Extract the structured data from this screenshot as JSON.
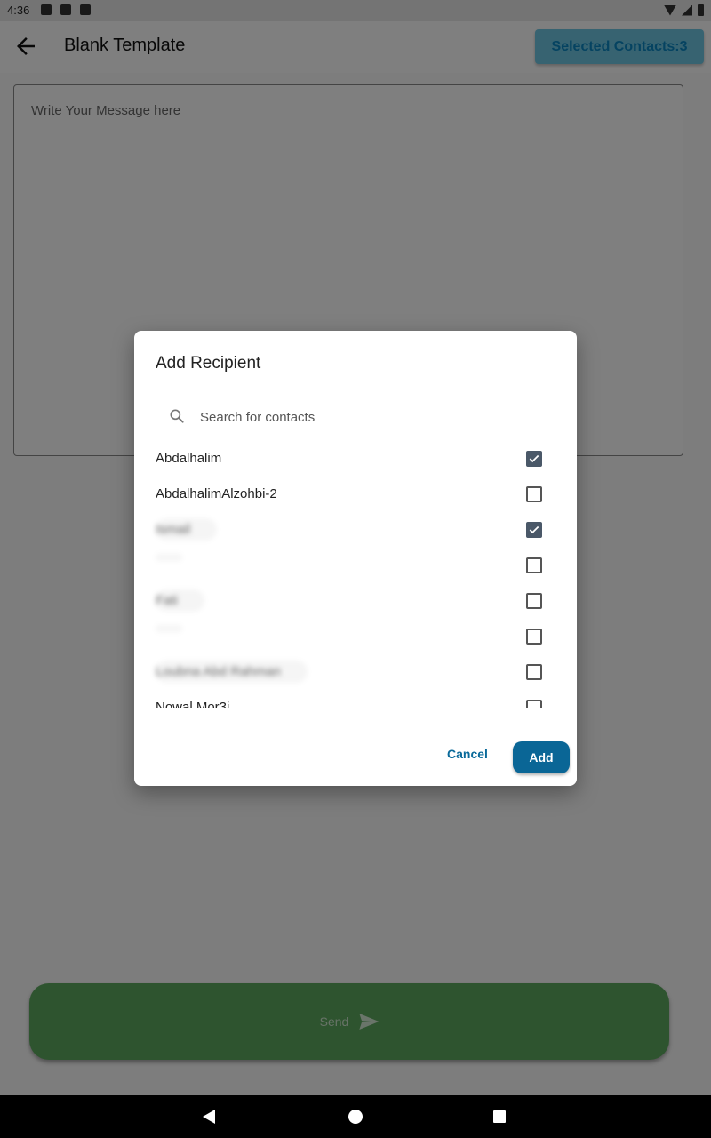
{
  "status_bar": {
    "time": "4:36",
    "icons": [
      "settings-icon",
      "a-icon",
      "sd-card-icon",
      "wifi-icon",
      "signal-icon",
      "battery-icon"
    ]
  },
  "app_bar": {
    "title": "Blank Template",
    "back_icon": "arrow-left-icon",
    "selected_contacts_label": "Selected Contacts:3"
  },
  "message": {
    "placeholder": "Write Your Message here",
    "value": ""
  },
  "send_button": {
    "label": "Send",
    "icon": "send-icon",
    "color": "#2e7d32"
  },
  "dialog": {
    "title": "Add Recipient",
    "search_placeholder": "Search for contacts",
    "contacts": [
      {
        "name": "Abdalhalim",
        "checked": true
      },
      {
        "name": "AbdalhalimAlzohbi-2",
        "checked": false
      },
      {
        "name": "Ismail",
        "checked": true
      },
      {
        "name": "",
        "checked": false
      },
      {
        "name": "Fati",
        "checked": false
      },
      {
        "name": "",
        "checked": false
      },
      {
        "name": "Loubna Abd Rahman",
        "checked": false
      },
      {
        "name": "Nowal Mor3i",
        "checked": false
      }
    ],
    "cancel_label": "Cancel",
    "add_label": "Add",
    "accent": "#006494"
  },
  "nav_bar": {
    "icons": [
      "back-triangle-icon",
      "home-circle-icon",
      "recents-square-icon"
    ]
  }
}
